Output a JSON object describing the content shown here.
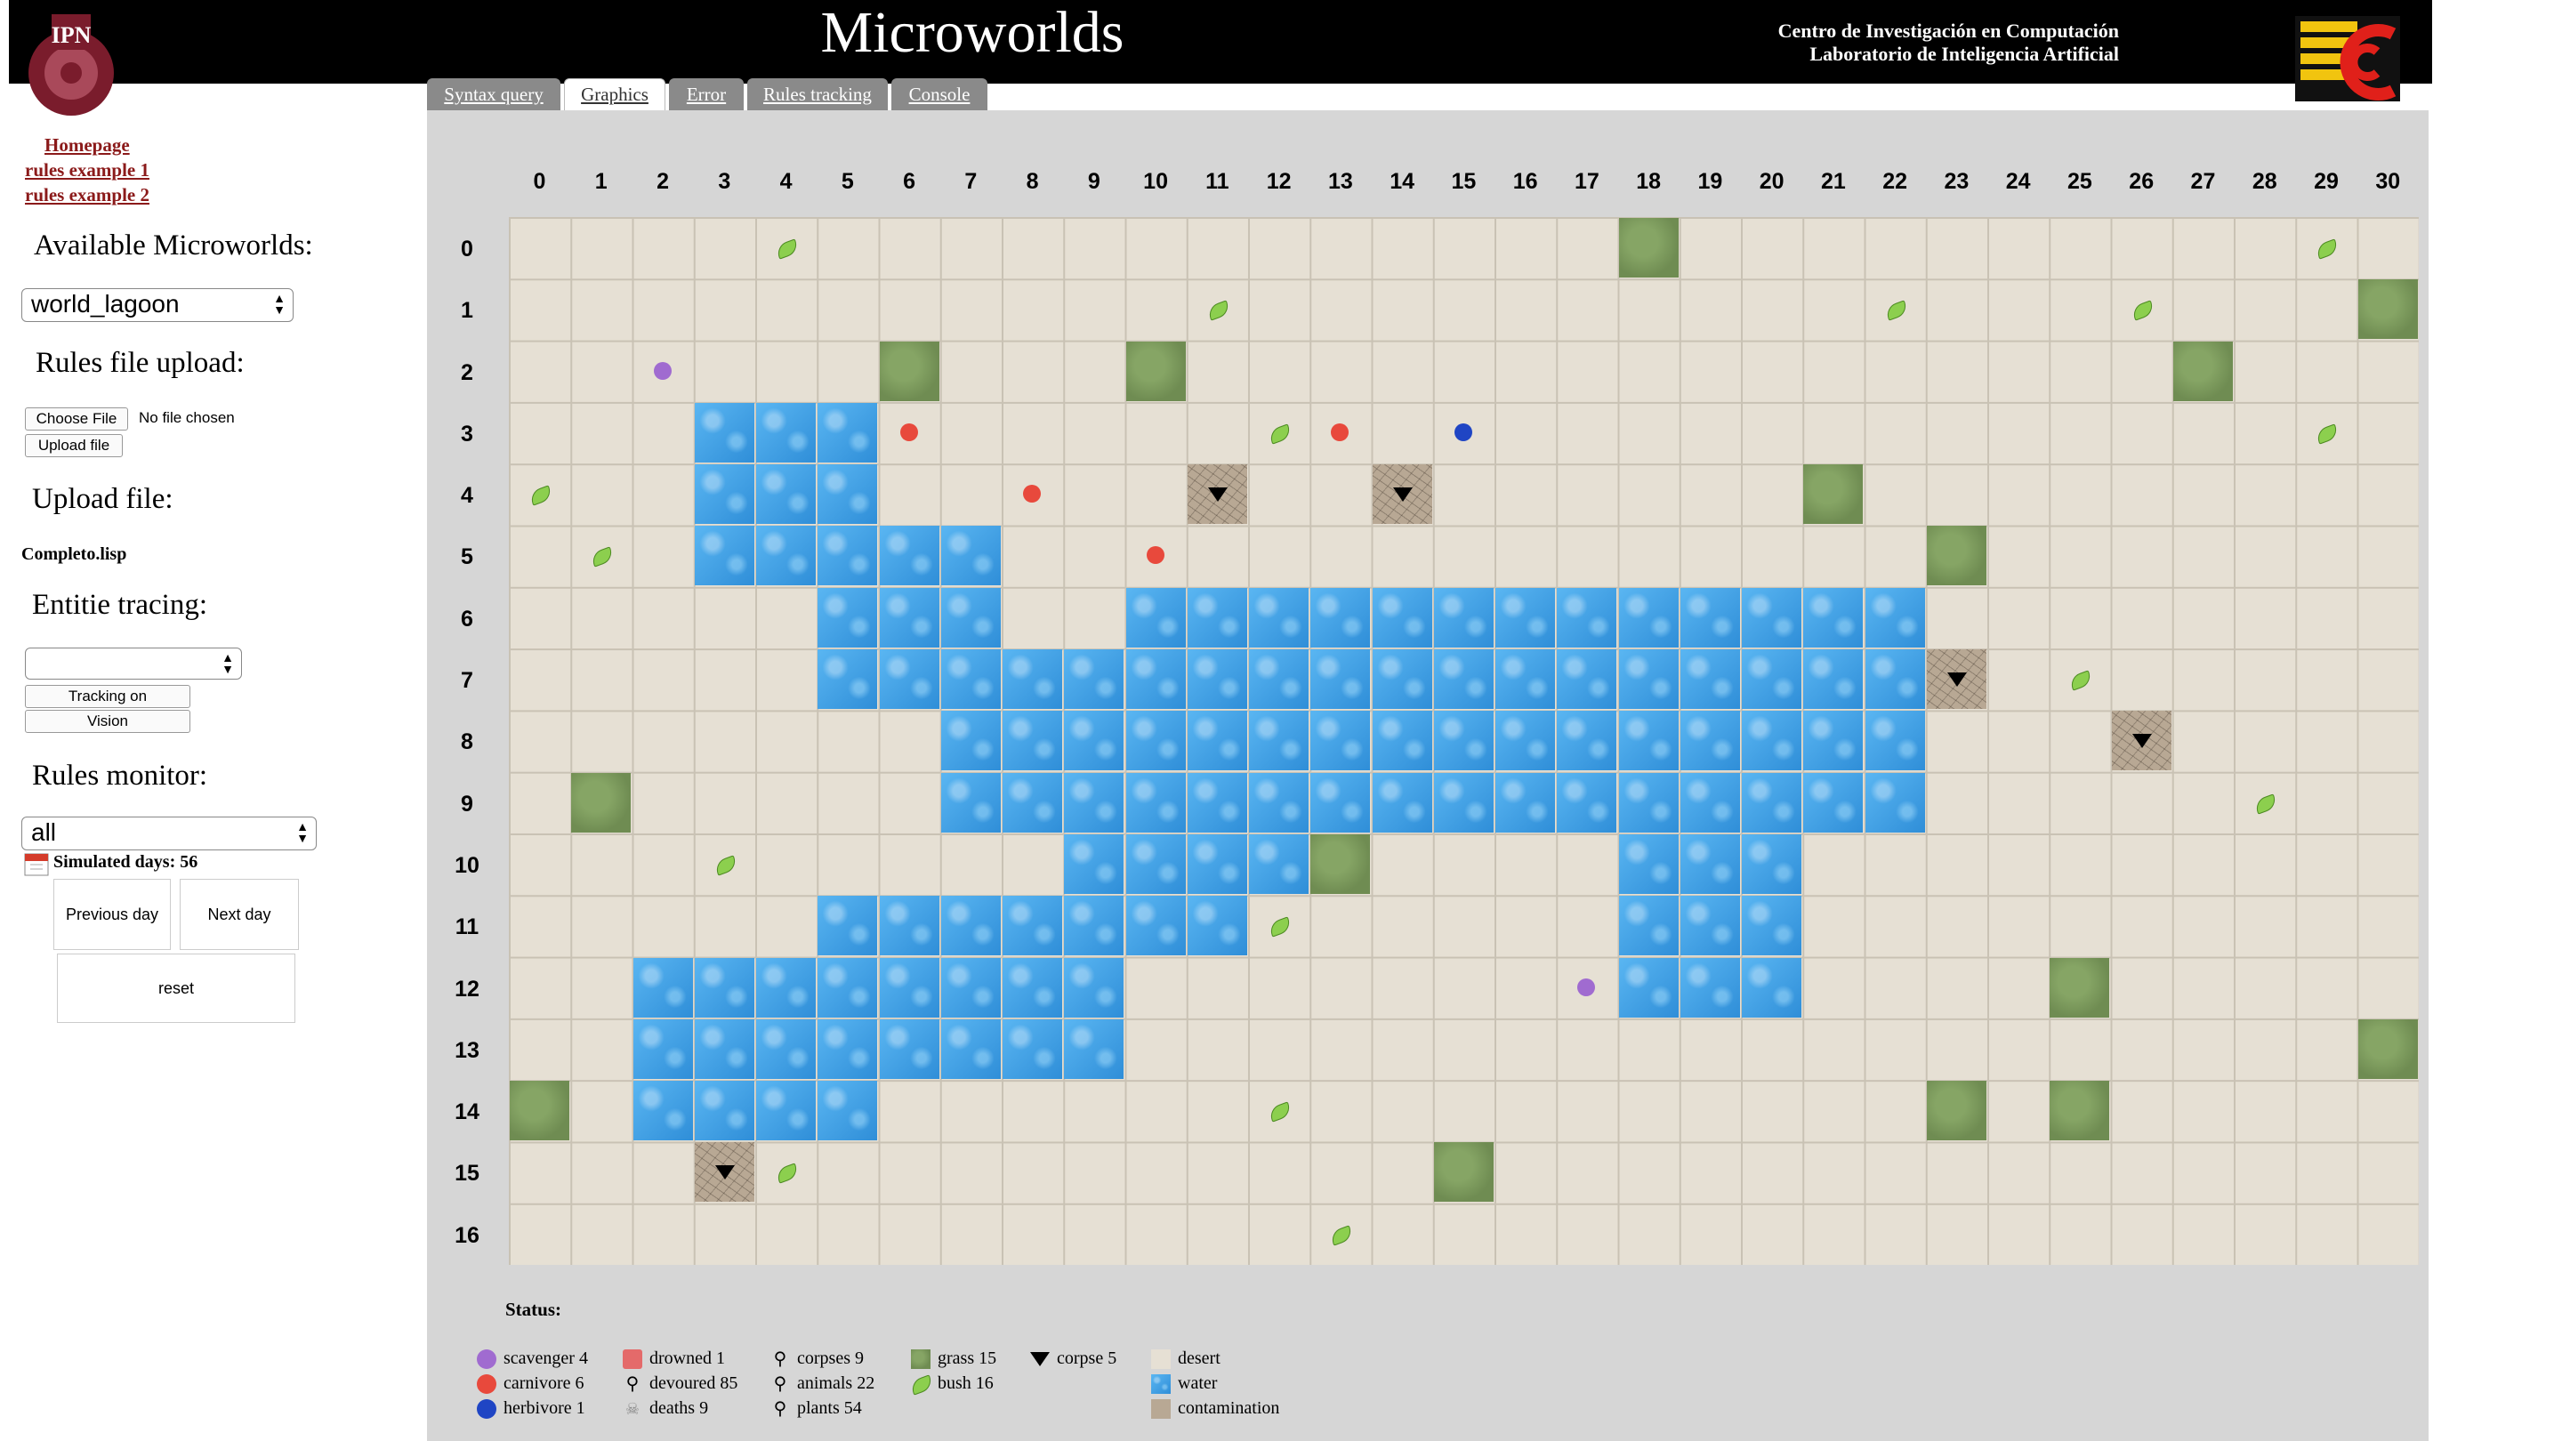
{
  "header": {
    "title": "Microworlds",
    "org_line1": "Centro de Investigación en Computación",
    "org_line2": "Laboratorio de Inteligencia Artificial"
  },
  "sidebar": {
    "links": [
      "Homepage",
      "rules example 1",
      "rules example 2"
    ],
    "available_label": "Available Microworlds:",
    "world_selected": "world_lagoon",
    "rules_upload_label": "Rules file upload:",
    "choose_file": "Choose File",
    "no_file": "No file chosen",
    "upload_file_button": "Upload file",
    "upload_label": "Upload file:",
    "current_file": "Completo.lisp",
    "tracing_label": "Entitie tracing:",
    "tracing_selected": "",
    "tracking_button": "Tracking on",
    "vision_button": "Vision",
    "monitor_label": "Rules monitor:",
    "monitor_selected": "all",
    "simulated_days": "Simulated days: 56",
    "prev_button": "Previous day",
    "next_button": "Next day",
    "reset_button": "reset"
  },
  "tabs": [
    {
      "label": "Syntax query",
      "active": false
    },
    {
      "label": "Graphics",
      "active": true
    },
    {
      "label": "Error",
      "active": false
    },
    {
      "label": "Rules tracking",
      "active": false
    },
    {
      "label": "Console",
      "active": false
    }
  ],
  "grid": {
    "columns": [
      "0",
      "1",
      "2",
      "3",
      "4",
      "5",
      "6",
      "7",
      "8",
      "9",
      "10",
      "11",
      "12",
      "13",
      "14",
      "15",
      "16",
      "17",
      "18",
      "19",
      "20",
      "21",
      "22",
      "23",
      "24",
      "25",
      "26",
      "27",
      "28",
      "29",
      "30"
    ],
    "rows": [
      "0",
      "1",
      "2",
      "3",
      "4",
      "5",
      "6",
      "7",
      "8",
      "9",
      "10",
      "11",
      "12",
      "13",
      "14",
      "15",
      "16"
    ],
    "water_runs": [
      [
        3,
        3,
        5
      ],
      [
        4,
        3,
        5
      ],
      [
        5,
        3,
        7
      ],
      [
        6,
        5,
        7
      ],
      [
        6,
        10,
        22
      ],
      [
        7,
        5,
        22
      ],
      [
        8,
        7,
        22
      ],
      [
        9,
        7,
        22
      ],
      [
        10,
        9,
        12
      ],
      [
        10,
        18,
        20
      ],
      [
        11,
        5,
        11
      ],
      [
        11,
        18,
        20
      ],
      [
        12,
        2,
        9
      ],
      [
        12,
        18,
        20
      ],
      [
        13,
        2,
        9
      ],
      [
        14,
        2,
        5
      ]
    ],
    "grass": [
      [
        0,
        18
      ],
      [
        1,
        30
      ],
      [
        2,
        6
      ],
      [
        2,
        10
      ],
      [
        2,
        27
      ],
      [
        4,
        21
      ],
      [
        5,
        23
      ],
      [
        9,
        1
      ],
      [
        10,
        13
      ],
      [
        12,
        25
      ],
      [
        13,
        30
      ],
      [
        14,
        0
      ],
      [
        14,
        23
      ],
      [
        14,
        25
      ],
      [
        15,
        15
      ]
    ],
    "contamination": [
      [
        4,
        11
      ],
      [
        4,
        14
      ],
      [
        7,
        23
      ],
      [
        8,
        26
      ],
      [
        15,
        3
      ]
    ],
    "bushes": [
      [
        0,
        4
      ],
      [
        0,
        29
      ],
      [
        1,
        11
      ],
      [
        1,
        22
      ],
      [
        1,
        26
      ],
      [
        3,
        12
      ],
      [
        3,
        29
      ],
      [
        4,
        0
      ],
      [
        5,
        1
      ],
      [
        7,
        25
      ],
      [
        9,
        28
      ],
      [
        10,
        3
      ],
      [
        11,
        12
      ],
      [
        14,
        12
      ],
      [
        15,
        4
      ],
      [
        16,
        13
      ]
    ],
    "scavengers": [
      [
        2,
        2
      ],
      [
        12,
        17
      ]
    ],
    "carnivores": [
      [
        3,
        6
      ],
      [
        3,
        13
      ],
      [
        4,
        8
      ],
      [
        5,
        10
      ]
    ],
    "herbivores": [
      [
        3,
        15
      ]
    ]
  },
  "colors": {
    "scavenger": "#a06bd0",
    "carnivore": "#e8493c",
    "herbivore": "#1f45c4"
  },
  "legend": {
    "status_label": "Status:",
    "scavenger": "scavenger 4",
    "carnivore": "carnivore  6",
    "herbivore": "herbivore  1",
    "drowned": "drowned   1",
    "devoured": "devoured 85",
    "deaths": "deaths      9",
    "corpses": "corpses  9",
    "animals": "animals 22",
    "plants": "plants   54",
    "grass": "grass 15",
    "bush": "bush  16",
    "corpse": "corpse 5",
    "desert": "desert",
    "water": "water",
    "contamination": "contamination"
  }
}
